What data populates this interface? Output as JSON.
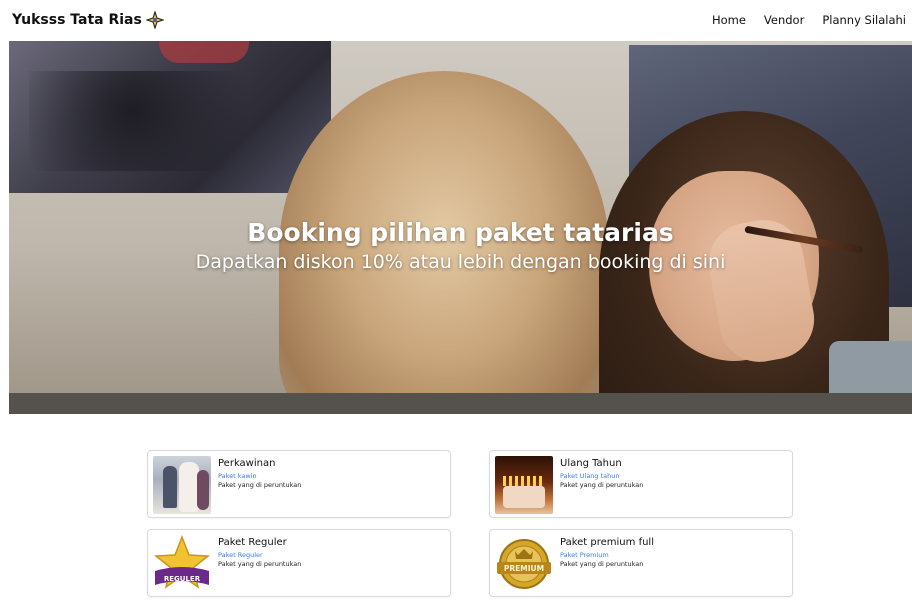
{
  "brand": {
    "name": "Yuksss Tata Rias",
    "icon": "sparkle-star-icon",
    "icon_color": "#f4c430"
  },
  "nav": {
    "items": [
      "Home",
      "Vendor",
      "Planny Silalahi"
    ]
  },
  "hero": {
    "title": "Booking pilihan paket tatarias",
    "subtitle": "Dapatkan diskon 10% atau lebih dengan booking di sini"
  },
  "cards": [
    {
      "title": "Perkawinan",
      "subtitle": "Paket kawin",
      "description": "Paket yang di peruntukan",
      "image": "wedding-photo"
    },
    {
      "title": "Ulang Tahun",
      "subtitle": "Paket Ulang tahun",
      "description": "Paket yang di peruntukan",
      "image": "birthday-cake-photo"
    },
    {
      "title": "Paket Reguler",
      "subtitle": "Paket Reguler",
      "description": "Paket yang di peruntukan",
      "image": "reguler-badge",
      "badge_text": "REGULER"
    },
    {
      "title": "Paket premium full",
      "subtitle": "Paket Premium",
      "description": "Paket yang di peruntukan",
      "image": "premium-badge",
      "badge_text": "PREMIUM"
    }
  ],
  "colors": {
    "link_blue": "#3b7de0",
    "card_border": "#d9d9d9",
    "gold": "#d4a62a",
    "purple": "#6b2a8a"
  }
}
